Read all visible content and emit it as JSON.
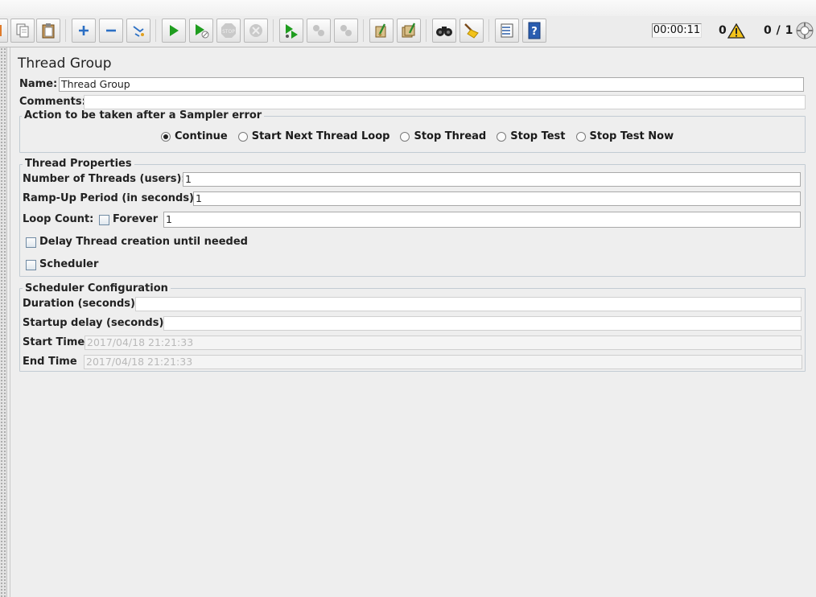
{
  "toolbar": {
    "buttons": [
      "copy-icon",
      "paste-icon",
      "expand-icon",
      "collapse-icon",
      "toggle-icon",
      "start-icon",
      "start-no-pauses-icon",
      "stop-icon",
      "shutdown-icon",
      "remote-start-icon",
      "remote-stop-icon",
      "remote-shutdown-icon",
      "clear-icon",
      "clear-all-icon",
      "search-icon",
      "reset-search-icon",
      "function-helper-icon",
      "help-icon"
    ],
    "timer": "00:00:11",
    "error_count": "0",
    "active_threads": "0 / 1",
    "colors": {
      "run_green": "#1f9d1f",
      "warning": "#e8b400"
    }
  },
  "panel": {
    "title": "Thread Group",
    "name_label": "Name:",
    "name_value": "Thread Group",
    "comments_label": "Comments:",
    "comments_value": ""
  },
  "sampler_error": {
    "legend": "Action to be taken after a Sampler error",
    "options": [
      "Continue",
      "Start Next Thread Loop",
      "Stop Thread",
      "Stop Test",
      "Stop Test Now"
    ],
    "selected": "Continue"
  },
  "thread_properties": {
    "legend": "Thread Properties",
    "threads_label": "Number of Threads (users):",
    "threads_value": "1",
    "rampup_label": "Ramp-Up Period (in seconds):",
    "rampup_value": "1",
    "loop_label": "Loop Count:",
    "forever_label": "Forever",
    "forever_checked": false,
    "loop_value": "1",
    "delay_label": "Delay Thread creation until needed",
    "delay_checked": false,
    "scheduler_label": "Scheduler",
    "scheduler_checked": false
  },
  "scheduler_config": {
    "legend": "Scheduler Configuration",
    "duration_label": "Duration (seconds)",
    "duration_value": "",
    "startup_label": "Startup delay (seconds)",
    "startup_value": "",
    "start_label": "Start Time",
    "start_value": "2017/04/18 21:21:33",
    "end_label": "End Time",
    "end_value": "2017/04/18 21:21:33"
  }
}
